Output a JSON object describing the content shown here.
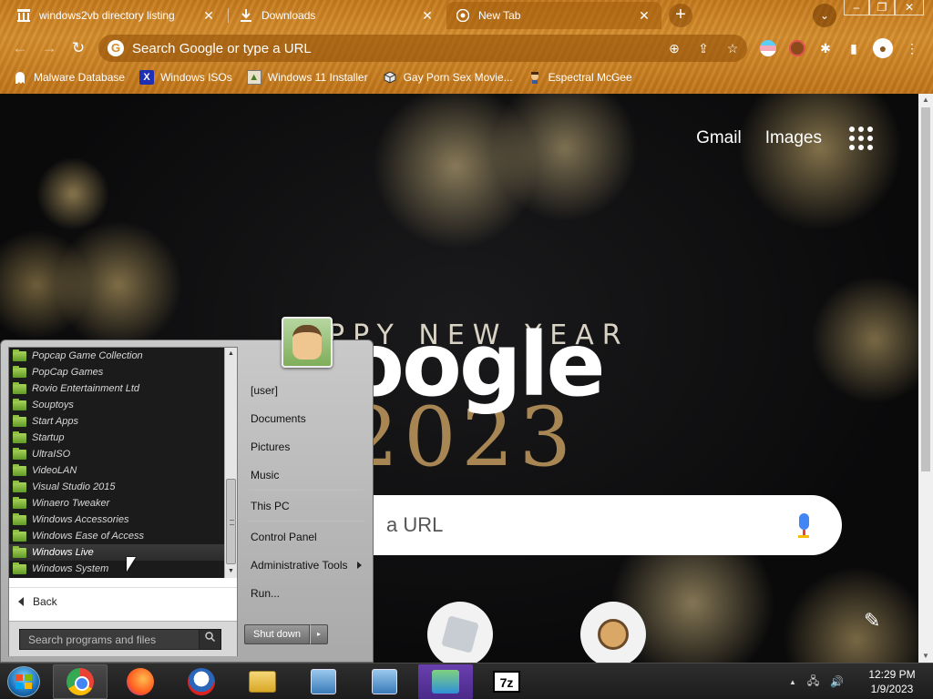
{
  "browser": {
    "tabs": [
      {
        "title": "windows2vb directory listing",
        "favicon": "archive-icon",
        "active": false
      },
      {
        "title": "Downloads",
        "favicon": "download-icon",
        "active": false
      },
      {
        "title": "New Tab",
        "favicon": "chrome-icon",
        "active": true
      }
    ],
    "new_tab_glyph": "+",
    "tab_close_glyph": "✕",
    "tab_search_glyph": "⌄",
    "window_controls": {
      "minimize": "–",
      "maximize": "❐",
      "close": "✕"
    },
    "nav": {
      "back": "←",
      "forward": "→",
      "reload": "↻"
    },
    "omnibox": {
      "placeholder": "Search Google or type a URL",
      "zoom_glyph": "⊕",
      "share_glyph": "⇪",
      "star_glyph": "☆"
    },
    "extensions": {
      "puzzle_glyph": "✱",
      "sidebar_glyph": "▮",
      "menu_glyph": "⋮",
      "profile_glyph": "●"
    },
    "bookmarks": [
      {
        "label": "Malware Database",
        "icon": "ghost-icon"
      },
      {
        "label": "Windows ISOs",
        "icon": "x-icon"
      },
      {
        "label": "Windows 11 Installer",
        "icon": "image-icon"
      },
      {
        "label": "Gay Porn Sex Movie...",
        "icon": "cube-icon"
      },
      {
        "label": "Espectral McGee",
        "icon": "character-icon"
      }
    ],
    "accent": "#d08628"
  },
  "newtab": {
    "links": {
      "gmail": "Gmail",
      "images": "Images"
    },
    "doodle": {
      "top_text": "PPY NEW YEAR",
      "logo_text": "oogle",
      "year_text": "2023"
    },
    "search_placeholder": "a URL",
    "customize_glyph": "✎"
  },
  "startmenu": {
    "programs": [
      "Popcap Game Collection",
      "PopCap Games",
      "Rovio Entertainment Ltd",
      "Souptoys",
      "Start Apps",
      "Startup",
      "UltraISO",
      "VideoLAN",
      "Visual Studio 2015",
      "Winaero Tweaker",
      "Windows Accessories",
      "Windows Ease of Access",
      "Windows Live",
      "Windows System"
    ],
    "highlighted_index": 12,
    "back_label": "Back",
    "search_placeholder": "Search programs and files",
    "right_items": {
      "user": "[user]",
      "documents": "Documents",
      "pictures": "Pictures",
      "music": "Music",
      "thispc": "This PC",
      "control_panel": "Control Panel",
      "admin_tools": "Administrative Tools",
      "run": "Run..."
    },
    "shutdown_label": "Shut down",
    "shutdown_arrow": "▸",
    "scroll_up": "▲",
    "scroll_down": "▼"
  },
  "taskbar": {
    "apps": [
      "chrome-icon",
      "firefox-icon",
      "obama-icon",
      "file-explorer-icon",
      "network-pc-icon",
      "network-pc-icon",
      "people-icon",
      "7zip-icon"
    ],
    "sevenzip_label": "7z",
    "tray": {
      "chevron": "▲",
      "network": "🖧",
      "volume": "🔊"
    },
    "clock": {
      "time": "12:29 PM",
      "date": "1/9/2023"
    }
  }
}
